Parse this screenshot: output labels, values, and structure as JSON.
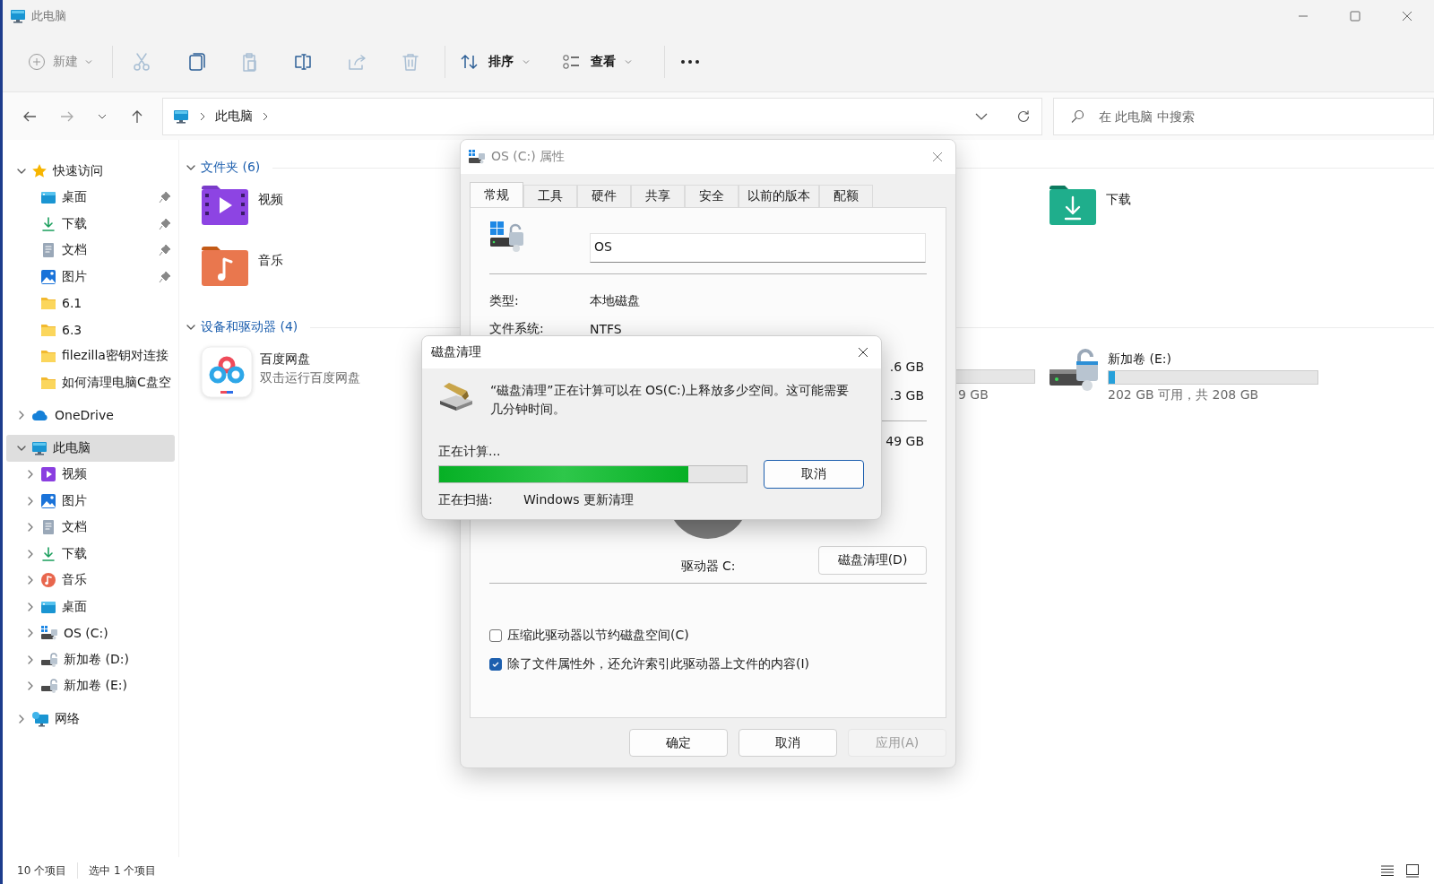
{
  "window": {
    "title": "此电脑"
  },
  "toolbar": {
    "new_button": {
      "label": "新建",
      "disabled": true
    },
    "actions": [
      {
        "kind": "cut",
        "disabled": true
      },
      {
        "kind": "copy",
        "disabled": false
      },
      {
        "kind": "paste",
        "disabled": true
      },
      {
        "kind": "rename",
        "disabled": false
      },
      {
        "kind": "share",
        "disabled": true
      },
      {
        "kind": "delete",
        "disabled": true
      }
    ],
    "sort_button": {
      "label": "排序"
    },
    "view_button": {
      "label": "查看"
    }
  },
  "address_bar": {
    "path": [
      "此电脑"
    ]
  },
  "search": {
    "placeholder": "在 此电脑 中搜索"
  },
  "sidebar": {
    "items": [
      {
        "label": "快速访问",
        "kind": "star",
        "expanded": true,
        "selected": false,
        "children": [
          {
            "label": "桌面",
            "kind": "desktop",
            "pinned": true,
            "selected": false
          },
          {
            "label": "下载",
            "kind": "download",
            "pinned": true,
            "selected": false
          },
          {
            "label": "文档",
            "kind": "document",
            "pinned": true,
            "selected": false
          },
          {
            "label": "图片",
            "kind": "picture",
            "pinned": true,
            "selected": false
          },
          {
            "label": "6.1",
            "kind": "folder",
            "pinned": false,
            "selected": false
          },
          {
            "label": "6.3",
            "kind": "folder",
            "pinned": false,
            "selected": false
          },
          {
            "label": "filezilla密钥对连接",
            "kind": "folder",
            "pinned": false,
            "selected": false
          },
          {
            "label": "如何清理电脑C盘空",
            "kind": "folder",
            "pinned": false,
            "selected": false
          }
        ]
      },
      {
        "label": "OneDrive",
        "kind": "cloud",
        "expanded": false,
        "selected": false
      },
      {
        "label": "此电脑",
        "kind": "computer",
        "expanded": true,
        "selected": true,
        "children": [
          {
            "label": "视频",
            "kind": "video",
            "expanded": false,
            "selected": false
          },
          {
            "label": "图片",
            "kind": "picture",
            "expanded": false,
            "selected": false
          },
          {
            "label": "文档",
            "kind": "document",
            "expanded": false,
            "selected": false
          },
          {
            "label": "下载",
            "kind": "download",
            "expanded": false,
            "selected": false
          },
          {
            "label": "音乐",
            "kind": "music",
            "expanded": false,
            "selected": false
          },
          {
            "label": "桌面",
            "kind": "desktop",
            "expanded": false,
            "selected": false
          },
          {
            "label": "OS (C:)",
            "kind": "drive-os",
            "expanded": false,
            "selected": false
          },
          {
            "label": "新加卷 (D:)",
            "kind": "drive",
            "expanded": false,
            "selected": false
          },
          {
            "label": "新加卷 (E:)",
            "kind": "drive",
            "expanded": false,
            "selected": false
          }
        ]
      },
      {
        "label": "网络",
        "kind": "network",
        "expanded": false,
        "selected": false
      }
    ]
  },
  "content": {
    "folders_header": {
      "title": "文件夹 (6)",
      "expanded": true
    },
    "folders": [
      {
        "name": "视频",
        "kind": "video"
      },
      {
        "name": "音乐",
        "kind": "music"
      },
      {
        "name": "下载",
        "kind": "download"
      }
    ],
    "devices_header": {
      "title": "设备和驱动器 (4)",
      "expanded": true
    },
    "devices": [
      {
        "kind": "app",
        "name": "百度网盘",
        "subtitle": "双击运行百度网盘"
      },
      {
        "kind": "drive-partial",
        "capacity_text": "9 GB"
      },
      {
        "kind": "drive",
        "name": "新加卷 (E:)",
        "level": 0.03,
        "capacity_text": "202 GB 可用，共 208 GB"
      }
    ]
  },
  "status_bar": {
    "item_count": "10 个项目",
    "selection": "选中 1 个项目"
  },
  "properties_dialog": {
    "title": "OS (C:) 属性",
    "tabs": [
      {
        "label": "常规",
        "selected": true
      },
      {
        "label": "工具",
        "selected": false
      },
      {
        "label": "硬件",
        "selected": false
      },
      {
        "label": "共享",
        "selected": false
      },
      {
        "label": "安全",
        "selected": false
      },
      {
        "label": "以前的版本",
        "selected": false
      },
      {
        "label": "配额",
        "selected": false
      }
    ],
    "name_value": "OS",
    "info": [
      {
        "label": "类型:",
        "value": "本地磁盘"
      },
      {
        "label": "文件系统:",
        "value": "NTFS"
      }
    ],
    "sizes": [
      ".6 GB",
      ".3 GB",
      "49 GB"
    ],
    "drive_label": "驱动器 C:",
    "cleanup_button": "磁盘清理(D)",
    "options": [
      {
        "label": "压缩此驱动器以节约磁盘空间(C)",
        "checked": false
      },
      {
        "label": "除了文件属性外，还允许索引此驱动器上文件的内容(I)",
        "checked": true
      }
    ],
    "buttons": [
      {
        "label": "确定",
        "disabled": false
      },
      {
        "label": "取消",
        "disabled": false
      },
      {
        "label": "应用(A)",
        "disabled": true
      }
    ]
  },
  "cleanup_dialog": {
    "title": "磁盘清理",
    "message": "“磁盘清理”正在计算可以在 OS(C:)上释放多少空间。这可能需要几分钟时间。",
    "progress_label": "正在计算...",
    "level": 0.81,
    "cancel_button": "取消",
    "scan_label": "正在扫描:",
    "scan_item": "Windows 更新清理"
  }
}
